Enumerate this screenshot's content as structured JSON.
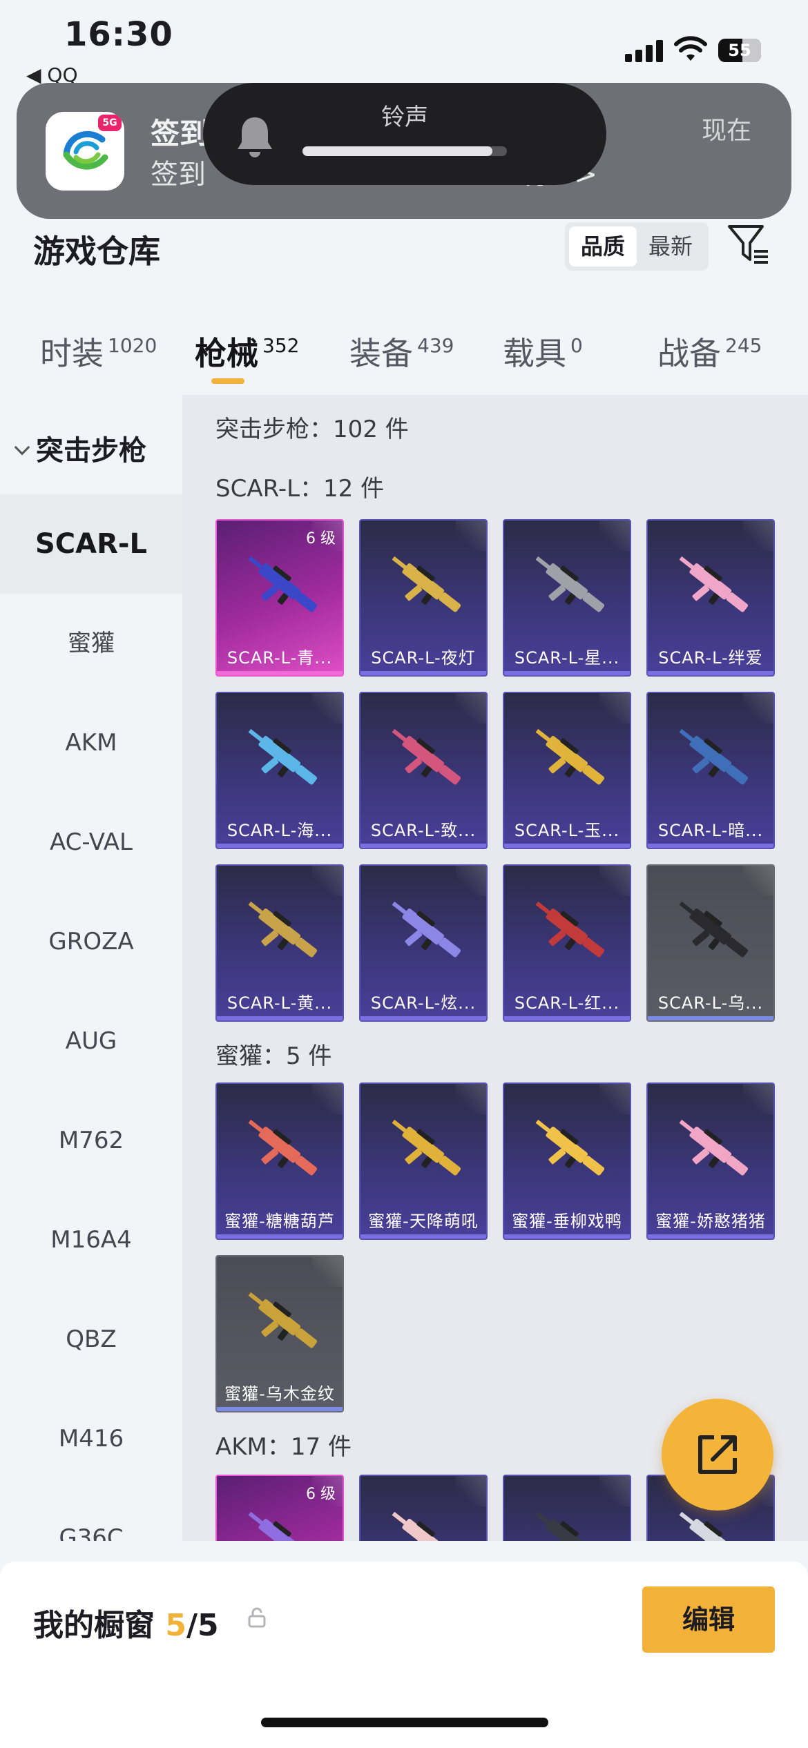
{
  "status_bar": {
    "time": "16:30",
    "back_app": "◀ QQ",
    "battery": "55"
  },
  "notification": {
    "title": "签到",
    "body": "签到",
    "body_tail": "券>>",
    "time": "现在"
  },
  "volume_hud": {
    "title": "铃声",
    "level": 0.93
  },
  "header": {
    "title": "游戏仓库",
    "sort_quality": "品质",
    "sort_latest": "最新"
  },
  "tabs": [
    {
      "label": "时装",
      "count": "1020"
    },
    {
      "label": "枪械",
      "count": "352"
    },
    {
      "label": "装备",
      "count": "439"
    },
    {
      "label": "载具",
      "count": "0"
    },
    {
      "label": "战备",
      "count": "245"
    }
  ],
  "sidebar": {
    "group": "突击步枪",
    "items": [
      "SCAR-L",
      "蜜獾",
      "AKM",
      "AC-VAL",
      "GROZA",
      "AUG",
      "M762",
      "M16A4",
      "QBZ",
      "M416",
      "G36C"
    ]
  },
  "content": {
    "total": "突击步枪：102 件",
    "sections": [
      {
        "title": "SCAR-L：12 件",
        "items": [
          {
            "name": "SCAR-L-青...",
            "level": "6 级",
            "tier": "purple",
            "color": "#3a47c8"
          },
          {
            "name": "SCAR-L-夜灯",
            "level": "",
            "tier": "blue",
            "color": "#d9b24a"
          },
          {
            "name": "SCAR-L-星...",
            "level": "",
            "tier": "blue",
            "color": "#9ea1a8"
          },
          {
            "name": "SCAR-L-绊爱",
            "level": "",
            "tier": "blue",
            "color": "#f0a6c8"
          },
          {
            "name": "SCAR-L-海...",
            "level": "",
            "tier": "blue",
            "color": "#5cb6e8"
          },
          {
            "name": "SCAR-L-致...",
            "level": "",
            "tier": "blue",
            "color": "#d4557e"
          },
          {
            "name": "SCAR-L-玉...",
            "level": "",
            "tier": "blue",
            "color": "#e0b43a"
          },
          {
            "name": "SCAR-L-暗...",
            "level": "",
            "tier": "blue",
            "color": "#3f6fb8"
          },
          {
            "name": "SCAR-L-黄...",
            "level": "",
            "tier": "blue",
            "color": "#c9a34a"
          },
          {
            "name": "SCAR-L-炫...",
            "level": "",
            "tier": "blue",
            "color": "#8c86e6"
          },
          {
            "name": "SCAR-L-红...",
            "level": "",
            "tier": "blue",
            "color": "#c23a3a"
          },
          {
            "name": "SCAR-L-乌...",
            "level": "",
            "tier": "gray",
            "color": "#2a2a2e"
          }
        ]
      },
      {
        "title": "蜜獾：5 件",
        "items": [
          {
            "name": "蜜獾-糖糖葫芦",
            "level": "",
            "tier": "blue",
            "color": "#e66a5a"
          },
          {
            "name": "蜜獾-天降萌吼",
            "level": "",
            "tier": "blue",
            "color": "#e0b23a"
          },
          {
            "name": "蜜獾-垂柳戏鸭",
            "level": "",
            "tier": "blue",
            "color": "#f0c24a"
          },
          {
            "name": "蜜獾-娇憨猪猪",
            "level": "",
            "tier": "blue",
            "color": "#f2a6c6"
          },
          {
            "name": "蜜獾-乌木金纹",
            "level": "",
            "tier": "gray",
            "color": "#c9a23a"
          }
        ]
      },
      {
        "title": "AKM：17 件",
        "items": [
          {
            "name": "",
            "level": "6 级",
            "tier": "purple",
            "color": "#8e6ee0"
          },
          {
            "name": "",
            "level": "",
            "tier": "blue",
            "color": "#f0c8c8"
          },
          {
            "name": "",
            "level": "",
            "tier": "blue",
            "color": "#3a3a44"
          },
          {
            "name": "",
            "level": "",
            "tier": "blue",
            "color": "#d8d8e0"
          }
        ]
      }
    ]
  },
  "bottom_bar": {
    "label": "我的橱窗",
    "count": "5",
    "total": "/5",
    "edit": "编辑"
  },
  "colors": {
    "accent": "#f2b23a",
    "card_blue": "#3b3678",
    "card_purple": "#a12b9e",
    "card_gray": "#5b5c65"
  }
}
